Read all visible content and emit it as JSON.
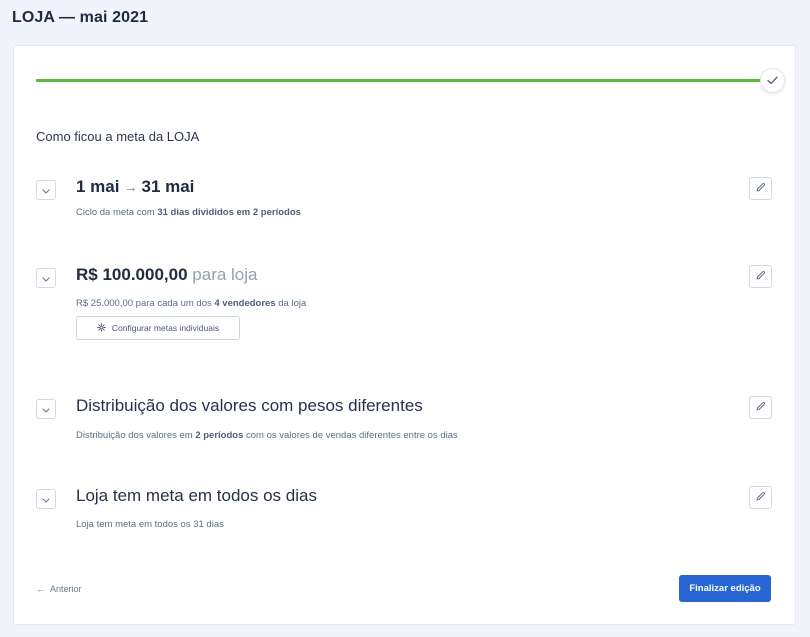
{
  "page": {
    "title": "LOJA — mai 2021"
  },
  "progress": {
    "percent": 100,
    "color": "#5bb840"
  },
  "section": {
    "heading": "Como ficou a meta da LOJA"
  },
  "cycle": {
    "start": "1 mai",
    "arrow": "→",
    "end": "31 mai",
    "sub_prefix": "Ciclo da meta com ",
    "sub_bold": "31 dias divididos em 2 períodos"
  },
  "target": {
    "value": "R$ 100.000,00",
    "suffix": "para loja",
    "sub_prefix": "R$ 25.000,00 para cada um dos ",
    "sub_bold": "4 vendedores",
    "sub_suffix": " da loja",
    "config_label": "Configurar metas individuais"
  },
  "distribution": {
    "title": "Distribuição dos valores com pesos diferentes",
    "sub_prefix": "Distribuição dos valores em ",
    "sub_bold": "2 períodos",
    "sub_suffix": " com os valores de vendas diferentes entre os dias"
  },
  "days": {
    "title": "Loja tem meta em todos os dias",
    "sub": "Loja tem meta em todos os 31 dias"
  },
  "footer": {
    "back_arrow": "←",
    "back_label": "Anterior",
    "finish_label": "Finalizar edição"
  },
  "colors": {
    "primary": "#2866d4",
    "success": "#5bb840",
    "background": "#f1f4fa"
  },
  "icons": [
    "check-icon",
    "chevron-down-icon",
    "pencil-icon",
    "gear-icon",
    "arrow-left-icon",
    "arrow-right-icon"
  ]
}
